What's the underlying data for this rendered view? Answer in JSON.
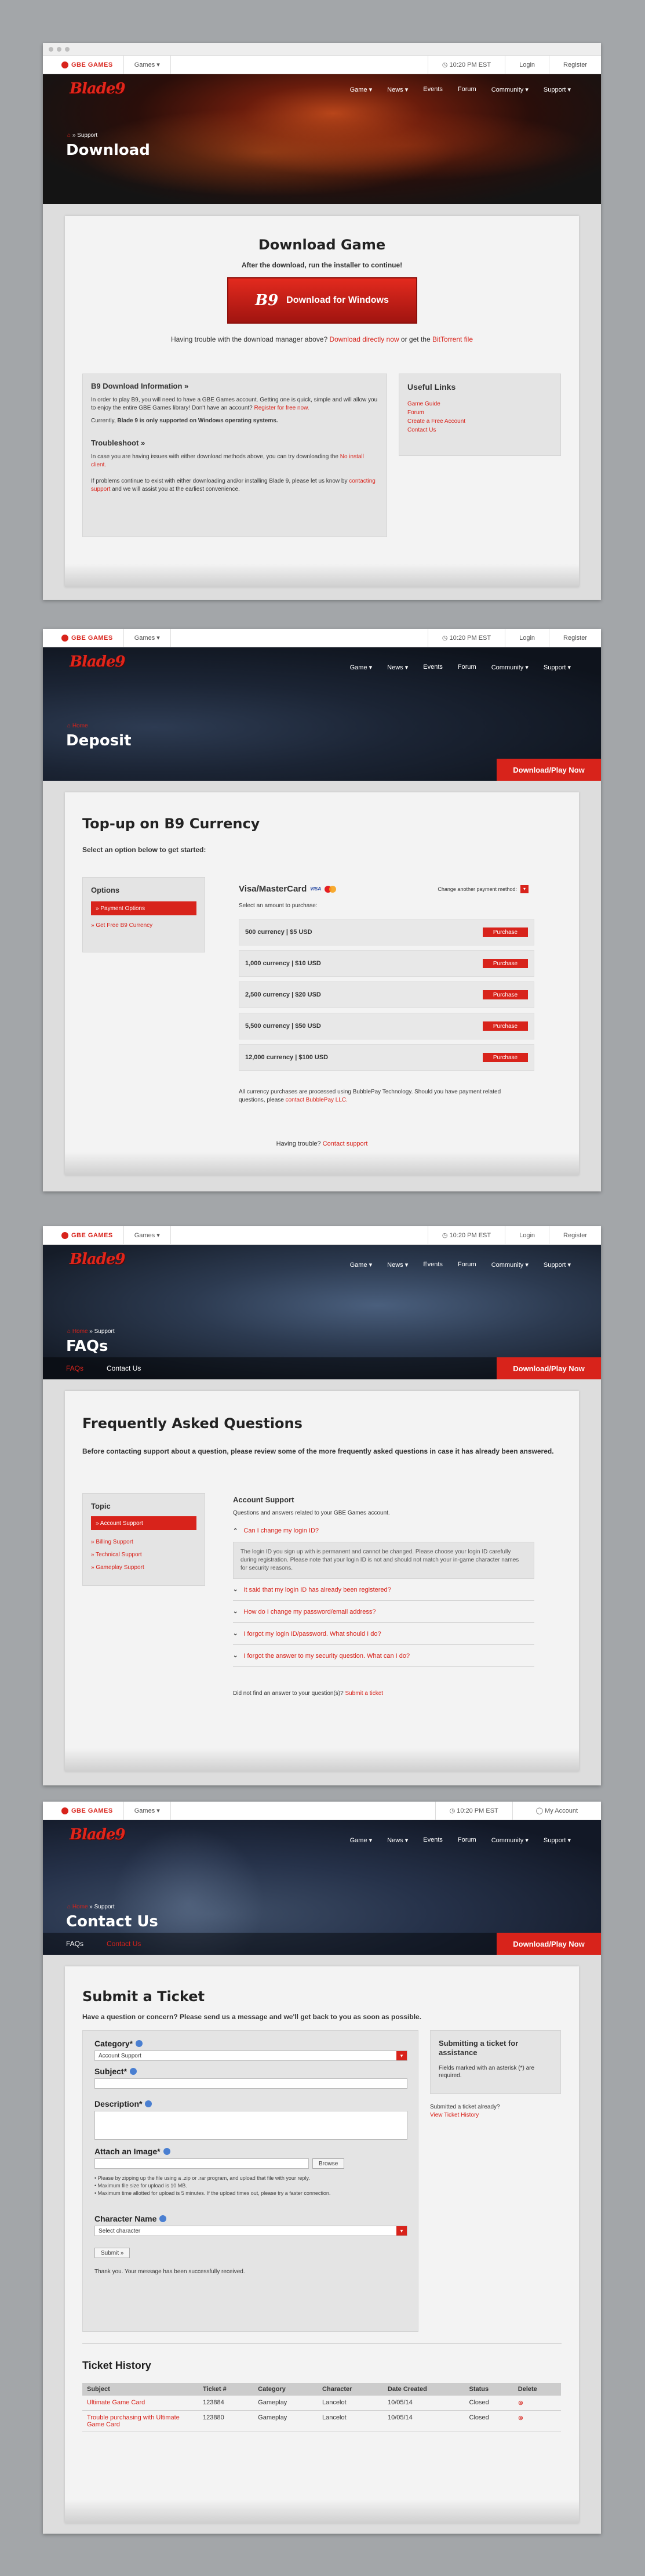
{
  "common": {
    "brand": "GBE GAMES",
    "games_menu": "Games ▾",
    "time": "10:20 PM EST",
    "login": "Login",
    "register": "Register",
    "my_account": "My Account",
    "logo_a": "Blade",
    "logo_b": "9",
    "nav": [
      "Game ▾",
      "News ▾",
      "Events",
      "Forum",
      "Community ▾",
      "Support ▾"
    ],
    "play_now": "Download/Play Now"
  },
  "download": {
    "breadcrumb_sep": "» Support",
    "title": "Download",
    "heading": "Download Game",
    "sub": "After the download, run the installer to continue!",
    "button": "Download for Windows",
    "trouble_pre": "Having trouble with the download manager above?",
    "trouble_link1": "Download directly now",
    "trouble_mid": "or get the",
    "trouble_link2": "BitTorrent file",
    "info_title": "B9 Download Information »",
    "info_p1": "In order to play B9, you will need to have a GBE Games account. Getting one is quick, simple and will allow you to enjoy the entire GBE Games library! Don't have an account?",
    "info_p1_link": "Register for free now.",
    "info_p2_pre": "Currently,",
    "info_p2_bold": "Blade 9 is only supported on Windows operating systems.",
    "ts_title": "Troubleshoot »",
    "ts_p1": "In case you are having issues with either download methods above, you can try downloading the",
    "ts_p1_link": "No install client.",
    "ts_p2": "If problems continue to exist with either downloading and/or installing Blade 9, please let us know by",
    "ts_p2_link": "contacting support",
    "ts_p2_end": "and we will assist you at the earliest convenience.",
    "links_title": "Useful Links",
    "links": [
      "Game Guide",
      "Forum",
      "Create a Free Account",
      "Contact Us"
    ]
  },
  "deposit": {
    "breadcrumb_home": "Home",
    "title": "Deposit",
    "heading": "Top-up on B9 Currency",
    "select": "Select an option below to get started:",
    "options_title": "Options",
    "opt_active": "» Payment Options",
    "opt_free": "» Get Free B9 Currency",
    "method": "Visa/MasterCard",
    "visa": "VISA",
    "change": "Change another payment method:",
    "amount": "Select an amount to purchase:",
    "purchase": "Purchase",
    "packages": [
      "500 currency | $5 USD",
      "1,000 currency | $10 USD",
      "2,500 currency | $20 USD",
      "5,500 currency | $50 USD",
      "12,000 currency | $100 USD"
    ],
    "note": "All currency purchases are processed using BubblePay Technology. Should you have payment related questions, please",
    "note_link": "contact BubblePay LLC.",
    "trouble": "Having trouble?",
    "trouble_link": "Contact support"
  },
  "faqs": {
    "breadcrumb_home": "Home",
    "breadcrumb_sep": "» Support",
    "title": "FAQs",
    "tab1": "FAQs",
    "tab2": "Contact Us",
    "heading": "Frequently Asked Questions",
    "intro": "Before contacting support about a question, please review some of the more frequently asked questions in case it has already been answered.",
    "topic_title": "Topic",
    "topics": [
      "» Account Support",
      "» Billing Support",
      "» Technical Support",
      "» Gameplay Support"
    ],
    "section_title": "Account Support",
    "section_sub": "Questions and answers related to your GBE Games account.",
    "q_open": "Can I change my login ID?",
    "a_open": "The login ID you sign up with is permanent and cannot be changed. Please choose your login ID carefully during registration. Please note that your login ID is not and should not match your in-game character names for security reasons.",
    "questions": [
      "It said that my login ID has already been registered?",
      "How do I change my password/email address?",
      "I forgot my login ID/password. What should I do?",
      "I forgot the answer to my security question. What can I do?"
    ],
    "footer": "Did not find an answer to your question(s)?",
    "footer_link": "Submit a ticket"
  },
  "contact": {
    "breadcrumb_home": "Home",
    "breadcrumb_sep": "» Support",
    "title": "Contact Us",
    "tab1": "FAQs",
    "tab2": "Contact Us",
    "heading": "Submit a Ticket",
    "sub": "Have a question or concern? Please send us a message and we'll get back to you as soon as possible.",
    "category": "Category*",
    "category_val": "Account Support",
    "subject": "Subject*",
    "description": "Description*",
    "attach": "Attach an Image*",
    "browse": "Browse",
    "notes": [
      "• Please by zipping up the file using a .zip or .rar program, and upload that file with your reply.",
      "• Maximum file size for upload is 10 MB.",
      "• Maximum time allotted for upload is 5 minutes. If the upload times out, please try a faster connection."
    ],
    "character": "Character Name",
    "character_val": "Select character",
    "submit": "Submit »",
    "thanks": "Thank you. Your message has been successfully received.",
    "side_title": "Submitting a ticket for assistance",
    "side_text": "Fields marked with an asterisk (*) are required.",
    "side_q": "Submitted a ticket already?",
    "side_link": "View Ticket History",
    "history_title": "Ticket History",
    "columns": [
      "Subject",
      "Ticket #",
      "Category",
      "Character",
      "Date Created",
      "Status",
      "Delete"
    ],
    "rows": [
      [
        "Ultimate Game Card",
        "123884",
        "Gameplay",
        "Lancelot",
        "10/05/14",
        "Closed"
      ],
      [
        "Trouble purchasing with Ultimate Game Card",
        "123880",
        "Gameplay",
        "Lancelot",
        "10/05/14",
        "Closed"
      ]
    ]
  }
}
